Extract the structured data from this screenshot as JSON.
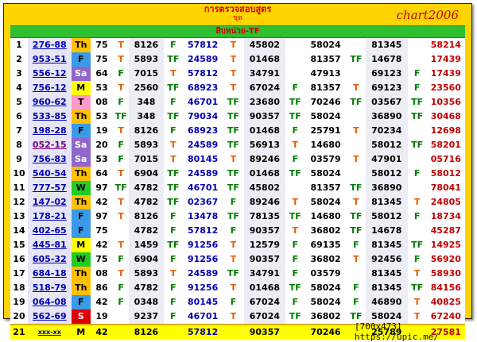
{
  "header": {
    "line1": "การตรวจสอบสูตร",
    "line2": "ชุด",
    "brand": "chart2006",
    "subtitle": "สิบหน่วย-TF"
  },
  "rows": [
    {
      "i": "1",
      "pair": "276-88",
      "day": "Th",
      "n1": "75",
      "m1": "T",
      "n2": "8126",
      "m2": "F",
      "n3": "57812",
      "m3": "T",
      "n4": "45802",
      "m4": "",
      "n5": "58024",
      "m5": "",
      "n6": "81345",
      "m6": "",
      "n7": "58214"
    },
    {
      "i": "2",
      "pair": "953-51",
      "day": "F",
      "n1": "75",
      "m1": "T",
      "n2": "5893",
      "m2": "TF",
      "n3": "24589",
      "m3": "T",
      "n4": "01468",
      "m4": "",
      "n5": "81357",
      "m5": "TF",
      "n6": "14678",
      "m6": "",
      "n7": "17439"
    },
    {
      "i": "3",
      "pair": "556-12",
      "day": "Sa",
      "n1": "64",
      "m1": "F",
      "n2": "7015",
      "m2": "T",
      "n3": "57812",
      "m3": "T",
      "n4": "34791",
      "m4": "",
      "n5": "47913",
      "m5": "",
      "n6": "69123",
      "m6": "F",
      "n7": "17439"
    },
    {
      "i": "4",
      "pair": "756-12",
      "day": "M",
      "n1": "53",
      "m1": "T",
      "n2": "2560",
      "m2": "TF",
      "n3": "68923",
      "m3": "T",
      "n4": "67024",
      "m4": "F",
      "n5": "81357",
      "m5": "T",
      "n6": "69123",
      "m6": "F",
      "n7": "23560"
    },
    {
      "i": "5",
      "pair": "960-62",
      "day": "T",
      "n1": "08",
      "m1": "F",
      "n2": "348",
      "m2": "F",
      "n3": "46701",
      "m3": "TF",
      "n4": "23680",
      "m4": "TF",
      "n5": "70246",
      "m5": "TF",
      "n6": "03567",
      "m6": "TF",
      "n7": "10356"
    },
    {
      "i": "6",
      "pair": "533-85",
      "day": "Th",
      "n1": "53",
      "m1": "TF",
      "n2": "348",
      "m2": "TF",
      "n3": "79034",
      "m3": "TF",
      "n4": "90357",
      "m4": "TF",
      "n5": "58024",
      "m5": "",
      "n6": "36890",
      "m6": "TF",
      "n7": "30468"
    },
    {
      "i": "7",
      "pair": "198-28",
      "day": "F",
      "n1": "19",
      "m1": "T",
      "n2": "8126",
      "m2": "F",
      "n3": "68923",
      "m3": "TF",
      "n4": "01468",
      "m4": "F",
      "n5": "25791",
      "m5": "T",
      "n6": "70234",
      "m6": "",
      "n7": "12698"
    },
    {
      "i": "8",
      "pair": "052-15",
      "day": "Sa",
      "n1": "20",
      "m1": "F",
      "n2": "5893",
      "m2": "T",
      "n3": "24589",
      "m3": "TF",
      "n4": "56913",
      "m4": "T",
      "n5": "14680",
      "m5": "",
      "n6": "58012",
      "m6": "TF",
      "n7": "58201"
    },
    {
      "i": "9",
      "pair": "756-83",
      "day": "Sa",
      "n1": "53",
      "m1": "F",
      "n2": "7015",
      "m2": "T",
      "n3": "80145",
      "m3": "T",
      "n4": "89246",
      "m4": "F",
      "n5": "03579",
      "m5": "T",
      "n6": "47901",
      "m6": "",
      "n7": "05716"
    },
    {
      "i": "10",
      "pair": "540-54",
      "day": "Th",
      "n1": "64",
      "m1": "T",
      "n2": "6904",
      "m2": "TF",
      "n3": "24589",
      "m3": "TF",
      "n4": "01468",
      "m4": "TF",
      "n5": "58024",
      "m5": "",
      "n6": "58012",
      "m6": "F",
      "n7": "58012"
    },
    {
      "i": "11",
      "pair": "777-57",
      "day": "W",
      "n1": "97",
      "m1": "TF",
      "n2": "4782",
      "m2": "TF",
      "n3": "46701",
      "m3": "TF",
      "n4": "45802",
      "m4": "",
      "n5": "81357",
      "m5": "TF",
      "n6": "36890",
      "m6": "",
      "n7": "78041"
    },
    {
      "i": "12",
      "pair": "147-02",
      "day": "Th",
      "n1": "42",
      "m1": "T",
      "n2": "4782",
      "m2": "TF",
      "n3": "02367",
      "m3": "F",
      "n4": "89246",
      "m4": "T",
      "n5": "58024",
      "m5": "T",
      "n6": "81345",
      "m6": "T",
      "n7": "24805"
    },
    {
      "i": "13",
      "pair": "178-21",
      "day": "F",
      "n1": "97",
      "m1": "T",
      "n2": "8126",
      "m2": "F",
      "n3": "13478",
      "m3": "TF",
      "n4": "78135",
      "m4": "TF",
      "n5": "14680",
      "m5": "TF",
      "n6": "58012",
      "m6": "F",
      "n7": "18734"
    },
    {
      "i": "14",
      "pair": "402-65",
      "day": "F",
      "n1": "75",
      "m1": "",
      "n2": "4782",
      "m2": "F",
      "n3": "57812",
      "m3": "F",
      "n4": "90357",
      "m4": "T",
      "n5": "36802",
      "m5": "TF",
      "n6": "14678",
      "m6": "",
      "n7": "45287"
    },
    {
      "i": "15",
      "pair": "445-81",
      "day": "M",
      "n1": "42",
      "m1": "T",
      "n2": "1459",
      "m2": "TF",
      "n3": "91256",
      "m3": "T",
      "n4": "12579",
      "m4": "F",
      "n5": "69135",
      "m5": "F",
      "n6": "81345",
      "m6": "TF",
      "n7": "14925"
    },
    {
      "i": "16",
      "pair": "605-32",
      "day": "W",
      "n1": "75",
      "m1": "F",
      "n2": "6904",
      "m2": "F",
      "n3": "91256",
      "m3": "T",
      "n4": "90357",
      "m4": "F",
      "n5": "36802",
      "m5": "T",
      "n6": "92456",
      "m6": "F",
      "n7": "56920"
    },
    {
      "i": "17",
      "pair": "684-18",
      "day": "Th",
      "n1": "08",
      "m1": "T",
      "n2": "5893",
      "m2": "T",
      "n3": "24589",
      "m3": "TF",
      "n4": "34791",
      "m4": "F",
      "n5": "03579",
      "m5": "",
      "n6": "81345",
      "m6": "T",
      "n7": "58930"
    },
    {
      "i": "18",
      "pair": "518-79",
      "day": "Th",
      "n1": "86",
      "m1": "F",
      "n2": "4782",
      "m2": "F",
      "n3": "91256",
      "m3": "T",
      "n4": "01468",
      "m4": "TF",
      "n5": "58024",
      "m5": "F",
      "n6": "81345",
      "m6": "TF",
      "n7": "84156"
    },
    {
      "i": "19",
      "pair": "064-08",
      "day": "F",
      "n1": "42",
      "m1": "F",
      "n2": "0348",
      "m2": "F",
      "n3": "80145",
      "m3": "F",
      "n4": "67024",
      "m4": "F",
      "n5": "58024",
      "m5": "F",
      "n6": "46890",
      "m6": "T",
      "n7": "40825"
    },
    {
      "i": "20",
      "pair": "562-69",
      "day": "S",
      "n1": "19",
      "m1": "",
      "n2": "9237",
      "m2": "F",
      "n3": "46701",
      "m3": "T",
      "n4": "67024",
      "m4": "TF",
      "n5": "36802",
      "m5": "TF",
      "n6": "58024",
      "m6": "T",
      "n7": "67240"
    }
  ],
  "total": {
    "i": "21",
    "pair": "xxx-xx",
    "day": "M",
    "n1": "42",
    "m1": "",
    "n2": "8126",
    "m2": "",
    "n3": "57812",
    "m3": "",
    "n4": "90357",
    "m4": "",
    "n5": "70246",
    "m5": "",
    "n6": "25789",
    "m6": "",
    "n7": "27581"
  },
  "footer": "[700x473] https://upic.me/",
  "colors": {
    "frame": "#ffd400",
    "subbar": "#2fbf2f",
    "red_text": "#c00000",
    "blue_text": "#0000b0"
  }
}
